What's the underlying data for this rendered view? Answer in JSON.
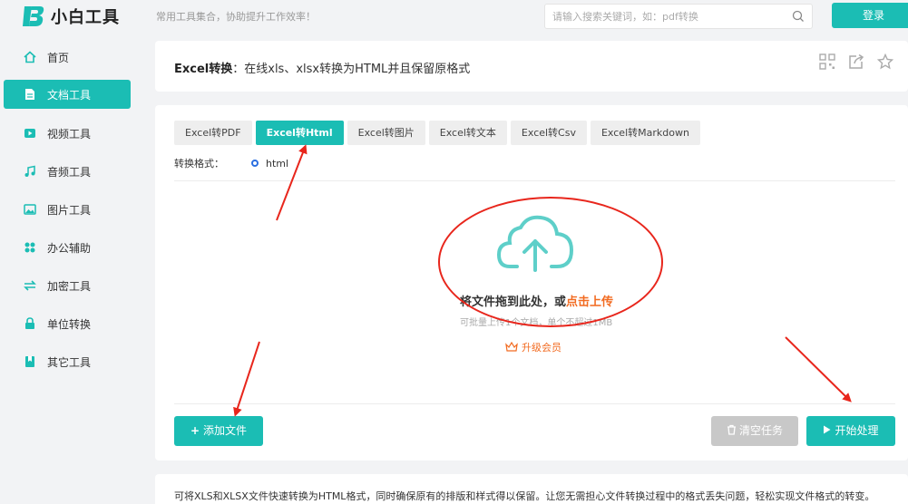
{
  "brand": {
    "name": "小白工具",
    "slogan": "常用工具集合，协助提升工作效率！",
    "accent": "#1bbdb4"
  },
  "search": {
    "placeholder": "请输入搜索关键词，如：pdf转换"
  },
  "login": {
    "label": "登录"
  },
  "sidebar": {
    "items": [
      {
        "label": "首页",
        "icon": "home-icon"
      },
      {
        "label": "文档工具",
        "icon": "document-icon",
        "active": true
      },
      {
        "label": "视频工具",
        "icon": "video-icon"
      },
      {
        "label": "音频工具",
        "icon": "music-icon"
      },
      {
        "label": "图片工具",
        "icon": "image-icon"
      },
      {
        "label": "办公辅助",
        "icon": "apps-icon"
      },
      {
        "label": "加密工具",
        "icon": "swap-icon"
      },
      {
        "label": "单位转换",
        "icon": "lock-icon"
      },
      {
        "label": "其它工具",
        "icon": "bookmark-icon"
      }
    ]
  },
  "page": {
    "title_bold": "Excel转换",
    "title_rest": "：在线xls、xlsx转换为HTML并且保留原格式"
  },
  "tabs": [
    "Excel转PDF",
    "Excel转Html",
    "Excel转图片",
    "Excel转文本",
    "Excel转Csv",
    "Excel转Markdown"
  ],
  "active_tab": 1,
  "format": {
    "label": "转换格式：",
    "option": "html"
  },
  "upload": {
    "main_prefix": "将文件拖到此处，或",
    "main_link": "点击上传",
    "sub": "可批量上传1个文档，单个不超过1MB",
    "upgrade": "升级会员"
  },
  "buttons": {
    "add": "添加文件",
    "clear": "清空任务",
    "start": "开始处理"
  },
  "description": "可将XLS和XLSX文件快速转换为HTML格式，同时确保原有的排版和样式得以保留。让您无需担心文件转换过程中的格式丢失问题，轻松实现文件格式的转变。"
}
